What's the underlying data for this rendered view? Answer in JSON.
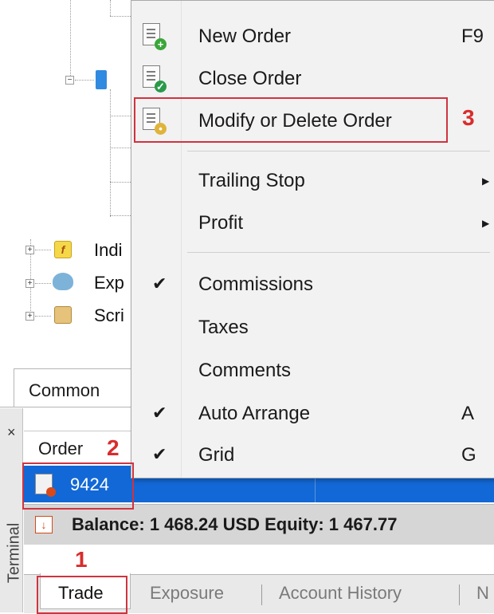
{
  "navigator": {
    "items": [
      {
        "label": "Indi",
        "icon": "indicator-icon"
      },
      {
        "label": "Exp",
        "icon": "expert-icon"
      },
      {
        "label": "Scri",
        "icon": "script-icon"
      }
    ],
    "common_tab": "Common"
  },
  "context_menu": {
    "items": [
      {
        "label": "New Order",
        "shortcut": "F9",
        "icon": "new-order-icon"
      },
      {
        "label": "Close Order",
        "icon": "close-order-icon"
      },
      {
        "label": "Modify or Delete Order",
        "icon": "modify-order-icon"
      },
      {
        "label": "Trailing Stop",
        "submenu": true
      },
      {
        "label": "Profit",
        "submenu": true
      },
      {
        "label": "Commissions",
        "checked": true
      },
      {
        "label": "Taxes",
        "checked": false
      },
      {
        "label": "Comments",
        "checked": false
      },
      {
        "label": "Auto Arrange",
        "shortcut": "A",
        "checked": true
      },
      {
        "label": "Grid",
        "shortcut": "G",
        "checked": true
      }
    ]
  },
  "terminal": {
    "side_label": "Terminal",
    "close_glyph": "×",
    "column_header": "Order",
    "order_number": "9424",
    "balance_text": "Balance: 1 468.24 USD  Equity: 1 467.77",
    "tabs": [
      "Trade",
      "Exposure",
      "Account History",
      "N"
    ]
  },
  "annotations": {
    "step1": "1",
    "step2": "2",
    "step3": "3"
  },
  "colors": {
    "selection_blue": "#1268d6",
    "highlight_red": "#d0333f"
  }
}
